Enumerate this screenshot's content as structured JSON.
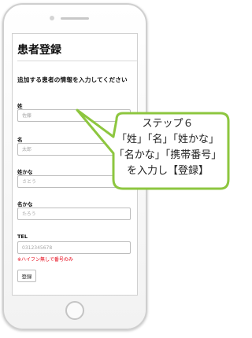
{
  "screen": {
    "title": "患者登録",
    "subtitle": "追加する患者の情報を入力してください"
  },
  "form": {
    "fields": [
      {
        "label": "姓",
        "placeholder": "佐藤"
      },
      {
        "label": "名",
        "placeholder": "太郎"
      },
      {
        "label": "姓かな",
        "placeholder": "さとう"
      },
      {
        "label": "名かな",
        "placeholder": "たろう"
      },
      {
        "label": "TEL",
        "placeholder": "0312345678"
      }
    ],
    "tel_hint": "※ハイフン無しで番号のみ",
    "submit_label": "登録"
  },
  "callout": {
    "lines": [
      "ステップ６",
      "「姓」「名」「姓かな」",
      "「名かな」「携帯番号」",
      "を入力し【登録】"
    ],
    "border_color": "#8dc63f"
  }
}
